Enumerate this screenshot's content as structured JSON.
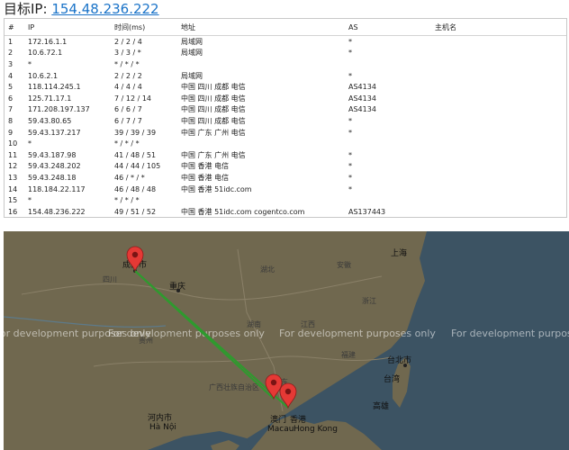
{
  "header": {
    "label": "目标IP:",
    "ip": "154.48.236.222"
  },
  "trace": {
    "columns": [
      "#",
      "IP",
      "时间(ms)",
      "地址",
      "AS",
      "主机名"
    ],
    "rows": [
      [
        "1",
        "172.16.1.1",
        "2 / 2 / 4",
        "局域网",
        "*",
        ""
      ],
      [
        "2",
        "10.6.72.1",
        "3 / 3 / *",
        "局域网",
        "*",
        ""
      ],
      [
        "3",
        "*",
        "* / * / *",
        "",
        "",
        ""
      ],
      [
        "4",
        "10.6.2.1",
        "2 / 2 / 2",
        "局域网",
        "*",
        ""
      ],
      [
        "5",
        "118.114.245.1",
        "4 / 4 / 4",
        "中国 四川 成都 电信",
        "AS4134",
        ""
      ],
      [
        "6",
        "125.71.17.1",
        "7 / 12 / 14",
        "中国 四川 成都 电信",
        "AS4134",
        ""
      ],
      [
        "7",
        "171.208.197.137",
        "6 / 6 / 7",
        "中国 四川 成都 电信",
        "AS4134",
        ""
      ],
      [
        "8",
        "59.43.80.65",
        "6 / 7 / 7",
        "中国 四川 成都 电信",
        "*",
        ""
      ],
      [
        "9",
        "59.43.137.217",
        "39 / 39 / 39",
        "中国 广东 广州 电信",
        "*",
        ""
      ],
      [
        "10",
        "*",
        "* / * / *",
        "",
        "",
        ""
      ],
      [
        "11",
        "59.43.187.98",
        "41 / 48 / 51",
        "中国 广东 广州 电信",
        "*",
        ""
      ],
      [
        "12",
        "59.43.248.202",
        "44 / 44 / 105",
        "中国 香港 电信",
        "*",
        ""
      ],
      [
        "13",
        "59.43.248.18",
        "46 / * / *",
        "中国 香港 电信",
        "*",
        ""
      ],
      [
        "14",
        "118.184.22.117",
        "46 / 48 / 48",
        "中国 香港 51idc.com",
        "*",
        ""
      ],
      [
        "15",
        "*",
        "* / * / *",
        "",
        "",
        ""
      ],
      [
        "16",
        "154.48.236.222",
        "49 / 51 / 52",
        "中国 香港 51idc.com cogentco.com",
        "AS137443",
        ""
      ]
    ]
  },
  "map": {
    "watermark": [
      "For development purposes only",
      "For development purposes only",
      "For development purposes only",
      "For development purposes only"
    ],
    "cities": {
      "chengdu": "成都市",
      "chongqing": "重庆",
      "shanghai": "上海",
      "taipei": "台北市",
      "taiwan": "台湾",
      "kaohsiung": "高雄",
      "hanoi_cn": "河内市",
      "hanoi": "Hà Nội",
      "macau_cn": "澳门",
      "hongkong_cn": "香港",
      "macau": "Macau",
      "hongkong": "Hong Kong"
    },
    "provinces": {
      "sichuan": "四川",
      "hubei": "湖北",
      "anhui": "安徽",
      "zhejiang": "浙江",
      "hunan": "湖南",
      "jiangxi": "江西",
      "fujian": "福建",
      "guizhou": "贵州",
      "guangxi": "广西壮族自治区",
      "guangdong": "广东"
    },
    "route_color": "#2e9a2e",
    "marker_color": "#e53935"
  }
}
